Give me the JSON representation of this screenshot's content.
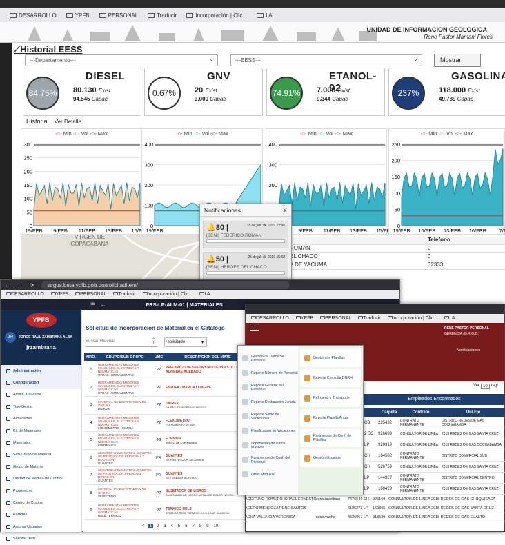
{
  "browser": {
    "bookmarks": [
      "DESARROLLO",
      "YPFB",
      "PERSONAL",
      "Traducir",
      "Incorporación | Clic...",
      "I A"
    ]
  },
  "header": {
    "org_title": "UNIDAD DE INFORMACION GEOLOGICA",
    "user_name": "Rene Pastor Mamani Flores"
  },
  "page": {
    "title": "Historial EESS",
    "departamento_placeholder": "---Departamento---",
    "eess_placeholder": "---EESS---",
    "show_button": "Mostrar",
    "tab_historial": "Historial",
    "tab_detalle": "Ver Detalle"
  },
  "fuel_cards": [
    {
      "name": "DIESEL",
      "percent": "84.75%",
      "exist": "80.130",
      "capac": "94.545",
      "color": "#9da6ad",
      "text_color": "#fff"
    },
    {
      "name": "GNV",
      "percent": "0.67%",
      "exist": "20",
      "capac": "3.000",
      "color": "#ffffff",
      "text_color": "#222"
    },
    {
      "name": "ETANOL-92",
      "percent": "74.91%",
      "exist": "7.000",
      "capac": "9.344",
      "color": "#3a9a4c",
      "text_color": "#fff"
    },
    {
      "name": "GASOLINA",
      "percent": "237%",
      "exist": "118.000",
      "capac": "49.789",
      "color": "#1d3e79",
      "text_color": "#fff"
    }
  ],
  "labels": {
    "exist": "Exist",
    "capac": "Capac"
  },
  "legend": [
    "Min",
    "Vol",
    "Max"
  ],
  "charts": [
    {
      "yticks": [
        "300",
        "250",
        "200",
        "150",
        "100",
        "50",
        "0"
      ],
      "xticks": [
        "19/FEB",
        "9/FEB",
        "11/FEB",
        "13/FEB",
        "15/FEB"
      ],
      "fill": "#f4cfa9"
    },
    {
      "yticks": [
        "400",
        "300",
        "200",
        "100",
        "0"
      ],
      "xticks": [
        "19/FEB",
        "13/FEB",
        "15/FEB"
      ],
      "fill": "#8ee0f0"
    },
    {
      "yticks": [
        "400",
        "300",
        "200",
        "100",
        "0"
      ],
      "xticks": [
        "19/FEB",
        "9/FEB",
        "11/FEB",
        "13/FEB",
        "15/FEB"
      ],
      "fill": "#3ab3c7"
    },
    {
      "yticks": [
        "250",
        "200",
        "150",
        "100",
        "50",
        "0"
      ],
      "xticks": [
        "19/FEB",
        "16/FEB",
        "13/FEB",
        "16/FEB",
        "7/F"
      ],
      "fill": "#3ab3c7"
    }
  ],
  "notifications": {
    "title": "Notificaciones",
    "close": "X",
    "items": [
      {
        "count": "80 |",
        "date": "18 de jun. de 2019 22:56",
        "text": "[BENI] FEDERICO ROMAN"
      },
      {
        "count": "50 |",
        "date": "25 de jul. de 2019 15:58",
        "text": "[BENI] HEROES DEL CHACO"
      }
    ]
  },
  "map_label": "VIRGEN DE COPACABANA",
  "station_table": {
    "header": "Telefono",
    "rows": [
      [
        "ROMAN",
        "0"
      ],
      [
        "EL CHACO",
        "0"
      ],
      [
        "A DE YACUMA",
        "32333"
      ]
    ]
  },
  "w2": {
    "url": "argos.beta.ypfb.gob.bo/solicitaditem/",
    "nav_title": "PRS-LP-ALM-01 | MATERIALES",
    "user_full": "JORGE RAUL ZAMBRANA ALBA",
    "username": "jrzambrana",
    "avatar": "JR",
    "logo": "YPFB",
    "side_items": [
      "Administración",
      "Configuración",
      "Admin. Usuarios",
      "Tipo Gestio",
      "Almacenes",
      "Kit de Materiales",
      "Materiales",
      "Sub Grupo de Material",
      "Grupo de Material",
      "Unidad de Medida de Control",
      "Parametros",
      "Centro de Costos",
      "Partidas",
      "Asignar Usuarios",
      "Solicitar Item"
    ],
    "page_title": "Solicitud de Incorporacion de Material en el Catalogo",
    "search_placeholder": "Buscar Material",
    "status_select": "solicitado",
    "columns": [
      "NRO.",
      "GRUPO/SUB GRUPO",
      "UMC",
      "DESCRIPCIÓN DEL MATE"
    ],
    "rows": [
      {
        "nro": "1",
        "grupo": "HERRAMIENTAS MENORES, MANUALES, ELECTRICAS Y NEUMATICAS",
        "sub": "OTRAS HERRAMIENTAS",
        "umc": "PZ",
        "desc": "PRECINTOS DE SEGURIDAD DE PLASTICO CON ALAMBRE ACERADO",
        "sub2": ""
      },
      {
        "nro": "2",
        "grupo": "HERRAMIENTAS MENORES, MANUALES, ELECTRICAS Y NEUMATICAS",
        "sub": "OTRAS HERRAMIENTAS",
        "umc": "PZ",
        "desc": "ESTUFA - MARCA LONGIVE",
        "sub2": ""
      },
      {
        "nro": "3",
        "grupo": "MATERIAL DE ESCRITORIO Y DE OFICINA",
        "sub": "DIUREX",
        "umc": "PZ",
        "desc": "DIUREX",
        "sub2": "DIUREX TRANSPARENTE DE 2\""
      },
      {
        "nro": "4",
        "grupo": "HERRAMIENTAS MENORES, MANUALES, ELECTRICAS Y NEUMATICAS",
        "sub": "FLEXOMETRO - MARCA",
        "umc": "PZ",
        "desc": "FLEXOMETRO",
        "sub2": "FLEXOMETRO DE 5MT"
      },
      {
        "nro": "5",
        "grupo": "HERRAMIENTAS MENORES, MANUALES, ELECTRICAS Y NEUMATICAS",
        "sub": "FORMONES",
        "umc": "JG",
        "desc": "FORMON",
        "sub2": "JUEGO DE CORMONES"
      },
      {
        "nro": "6",
        "grupo": "SEGURIDAD INDUSTRIAL, EQUIPOS DE PROTECCIÓN PERSONAL Y DOTACIÓN",
        "sub": "GUANTES",
        "umc": "PR",
        "desc": "GUANTES",
        "sub2": "DE PROTECCION MECANICA"
      },
      {
        "nro": "7",
        "grupo": "SEGURIDAD INDUSTRIAL, EQUIPOS DE PROTECCIÓN PERSONAL Y DOTACIÓN",
        "sub": "GUANTES",
        "umc": "PR",
        "desc": "GUANTES",
        "sub2": "DE TRABAJO MOTEADO"
      },
      {
        "nro": "8",
        "grupo": "MATERIAL DE ESCRITORIO Y DE OFICINA",
        "sub": "SEVISTERO",
        "umc": "PZ",
        "desc": "SUJETADOR DE LIBROS",
        "sub2": "SUJETADOR DE LIBROS METALICO COLOR NEGRO"
      },
      {
        "nro": "9",
        "grupo": "HERRAMIENTAS MENORES, MANUALES, ELECTRICAS Y NEUMATICAS",
        "sub": "RELÉ TERMICO",
        "umc": "PZ",
        "desc": "TERMICO RELE",
        "sub2": "TERMICO RELE TERMICO 4.5-6.3 AMP CLASE 10"
      }
    ],
    "pages": [
      "<",
      "1",
      "2",
      "3",
      "4",
      "5",
      "6",
      "7",
      "8",
      "9",
      "10"
    ]
  },
  "w3": {
    "user": "RENE PASTOR PERSONAL",
    "dept": "GERENCIA (G.R.G.D.)",
    "notif_label": "Notificaciones",
    "ver_label": "Ver",
    "ver_value": "10",
    "ver_suffix": "regi",
    "found_label": "Empleados Encontrados",
    "columns": [
      "Carpeta",
      "Contrato",
      "Uni.Eje"
    ],
    "menu_left": [
      "Gestión de Datos del Personal",
      "Reporte Número de Personal",
      "Reporte General del Personal",
      "Reporte Declaración Jurada",
      "Reporte Saldo de Vacaciones",
      "Planificacion de Vacaciones",
      "Importacion de Datos Masivos",
      "Parámetros de Conf. del Personal",
      "Otros Modulos"
    ],
    "menu_right": [
      "Gestión de Planillas",
      "Reporte Consulta DNRH",
      "Refrigerio y Transporte",
      "Reporte Planilla Anual",
      "Parámetros de Conf. de Planillas",
      "Gestión Usuarios"
    ],
    "rows": [
      {
        "ci": "CB",
        "carpeta": "225432",
        "contrato": "CONTRATO PERMANENTE",
        "unidad": "DISTRITO REDES DE GAS COCHABAMBA"
      },
      {
        "ci": "2 SC",
        "carpeta": "926699",
        "contrato": "CONSULTOR DE LINEA",
        "unidad": "2018 REDES DE GAS SANTA CRUZ"
      },
      {
        "ci": "LP",
        "carpeta": "920319",
        "contrato": "CONSULTOR DE LINEA",
        "unidad": "2018 REDES DE GAS COCHABAMBA"
      },
      {
        "ci": "CH",
        "carpeta": "164582",
        "contrato": "CONTRATO PERMANENTE",
        "unidad": "DISTRITO COMERCIAL SUD"
      },
      {
        "ci": "CH",
        "carpeta": "526759",
        "contrato": "CONSULTOR DE LINEA",
        "unidad": "2018 REDES DE GAS SANTA CRUZ"
      },
      {
        "ci": "LP",
        "carpeta": "144927",
        "contrato": "CONTRATO PERMANENTE",
        "unidad": "DISTRITO COMERCIAL CENTRO"
      },
      {
        "ci": "LP",
        "carpeta": "169429",
        "contrato": "CONTRATO PERMANENTE",
        "unidad": "2018 REDES DE GAS SANTA CRUZ"
      }
    ],
    "lower_rows": [
      {
        "name": "ACEITUNO ROMERO ISRAEL ERNESTO",
        "user": "cons.iaceituno",
        "ci": "7476549 CH",
        "carpeta": "925169",
        "contrato": "CONSULTOR DE LINEA",
        "unidad": "2018 REDES DE GAS CHUQUISACA"
      },
      {
        "name": "ACERO MENDOZA RENE SANTOS",
        "user": "",
        "ci": "6106273 LP",
        "carpeta": "169365",
        "contrato": "CONSULTOR DE LINEA",
        "unidad": "2018 REDES DE GAS SANTA CRUZ"
      },
      {
        "name": "ACHA VALENCIA VERONICA",
        "user": "cons.vacha",
        "ci": "4526067 LP",
        "carpeta": "918539",
        "contrato": "CONSULTOR DE LINEA",
        "unidad": "2018 REDES DE GAS EL ALTO"
      }
    ]
  }
}
